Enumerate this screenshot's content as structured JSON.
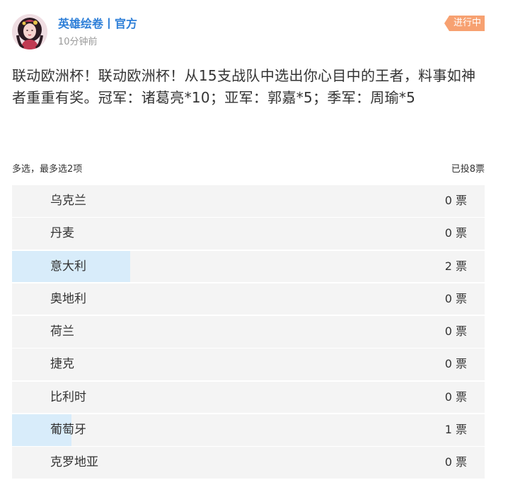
{
  "author": {
    "name": "英雄绘卷丨官方",
    "time": "10分钟前",
    "avatar_icon": "avatar-portrait-icon"
  },
  "status": {
    "label": "进行中",
    "color": "#f7a171"
  },
  "post": {
    "text": "联动欧洲杯！联动欧洲杯！从15支战队中选出你心目中的王者，料事如神者重重有奖。冠军：诸葛亮*10；亚军：郭嘉*5；季军：周瑜*5"
  },
  "poll": {
    "mode": "多选，最多选2项",
    "total": "已投8票",
    "total_votes": 8,
    "fill_color": "#d8ecfa",
    "options": [
      {
        "label": "乌克兰",
        "votes": 0,
        "count_text": "0 票"
      },
      {
        "label": "丹麦",
        "votes": 0,
        "count_text": "0 票"
      },
      {
        "label": "意大利",
        "votes": 2,
        "count_text": "2 票"
      },
      {
        "label": "奥地利",
        "votes": 0,
        "count_text": "0 票"
      },
      {
        "label": "荷兰",
        "votes": 0,
        "count_text": "0 票"
      },
      {
        "label": "捷克",
        "votes": 0,
        "count_text": "0 票"
      },
      {
        "label": "比利时",
        "votes": 0,
        "count_text": "0 票"
      },
      {
        "label": "葡萄牙",
        "votes": 1,
        "count_text": "1 票"
      },
      {
        "label": "克罗地亚",
        "votes": 0,
        "count_text": "0 票"
      }
    ]
  }
}
